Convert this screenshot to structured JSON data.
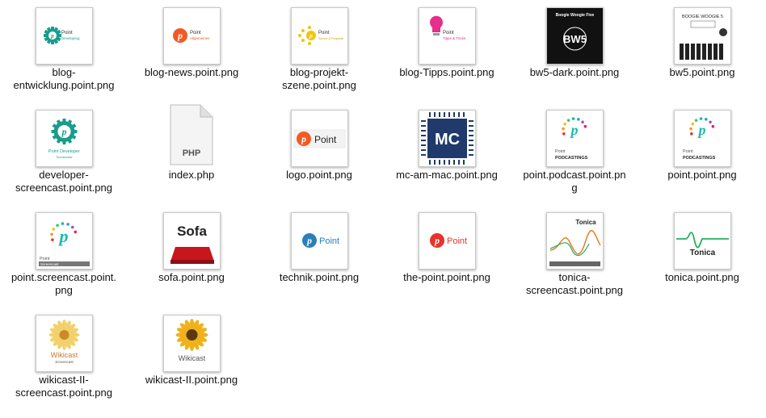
{
  "files": [
    {
      "id": "blog-entwicklung",
      "lines": [
        "blog-",
        "entwicklung.point.png"
      ],
      "thumb": "gear-teal",
      "thumb_text": [
        "Point",
        "Developing"
      ]
    },
    {
      "id": "blog-news",
      "lines": [
        "blog-news.point.png"
      ],
      "thumb": "orange-p",
      "thumb_text": [
        "Point",
        "Allgemeines"
      ]
    },
    {
      "id": "blog-projekt-szene",
      "lines": [
        "blog-projekt-",
        "szene.point.png"
      ],
      "thumb": "yellow-dots",
      "thumb_text": [
        "Point",
        "Szene & Projekte"
      ]
    },
    {
      "id": "blog-tipps",
      "lines": [
        "blog-Tipps.point.png"
      ],
      "thumb": "pink-bulb",
      "thumb_text": [
        "Point",
        "Tipps & Tricks"
      ]
    },
    {
      "id": "bw5-dark",
      "lines": [
        "bw5-dark.point.png"
      ],
      "thumb": "bw5-dark",
      "thumb_text": [
        "Boogie Woogie Five",
        "BW5"
      ]
    },
    {
      "id": "bw5",
      "lines": [
        "bw5.point.png"
      ],
      "thumb": "bw5-light",
      "thumb_text": [
        "BOOGIE WOOGIE 5"
      ]
    },
    {
      "id": "developer-screencast",
      "lines": [
        "developer-",
        "screencast.point.png"
      ],
      "thumb": "gear-teal-big",
      "thumb_text": [
        "Point Developer",
        "Screencast"
      ]
    },
    {
      "id": "index-php",
      "lines": [
        "index.php"
      ],
      "thumb": "php",
      "thumb_text": [
        "PHP"
      ]
    },
    {
      "id": "logo",
      "lines": [
        "logo.point.png"
      ],
      "thumb": "logo",
      "thumb_text": [
        "Point"
      ]
    },
    {
      "id": "mc-am-mac",
      "lines": [
        "mc-am-mac.point.png"
      ],
      "thumb": "mc",
      "thumb_text": [
        "MC"
      ]
    },
    {
      "id": "point-podcast",
      "lines": [
        "point.podcast.point.pn",
        "g"
      ],
      "thumb": "podcast",
      "thumb_text": [
        "Point",
        "PODCASTINGS"
      ]
    },
    {
      "id": "point-podcast2",
      "lines": [
        "point.point.png"
      ],
      "thumb": "podcast",
      "thumb_text": [
        "Point",
        "PODCASTINGS"
      ]
    },
    {
      "id": "point-screencast",
      "lines": [
        "point.screencast.point.",
        "png"
      ],
      "thumb": "screencast",
      "thumb_text": [
        "Point",
        "Screencast"
      ]
    },
    {
      "id": "sofa",
      "lines": [
        "sofa.point.png"
      ],
      "thumb": "sofa",
      "thumb_text": [
        "Sofa"
      ]
    },
    {
      "id": "technik",
      "lines": [
        "technik.point.png"
      ],
      "thumb": "blue-p",
      "thumb_text": [
        "Point"
      ]
    },
    {
      "id": "the-point",
      "lines": [
        "the-point.point.png"
      ],
      "thumb": "red-p",
      "thumb_text": [
        "Point"
      ]
    },
    {
      "id": "tonica-screencast",
      "lines": [
        "tonica-",
        "screencast.point.png"
      ],
      "thumb": "tonica-sc",
      "thumb_text": [
        "Tonica"
      ]
    },
    {
      "id": "tonica",
      "lines": [
        "tonica.point.png"
      ],
      "thumb": "tonica",
      "thumb_text": [
        "Tonica"
      ]
    },
    {
      "id": "wikicast-ii-screencast",
      "lines": [
        "wikicast-II-",
        "screencast.point.png"
      ],
      "thumb": "wikicast-sc",
      "thumb_text": [
        "Wikicast",
        "Screencast"
      ]
    },
    {
      "id": "wikicast-ii",
      "lines": [
        "wikicast-II.point.png"
      ],
      "thumb": "wikicast",
      "thumb_text": [
        "Wikicast"
      ]
    }
  ]
}
